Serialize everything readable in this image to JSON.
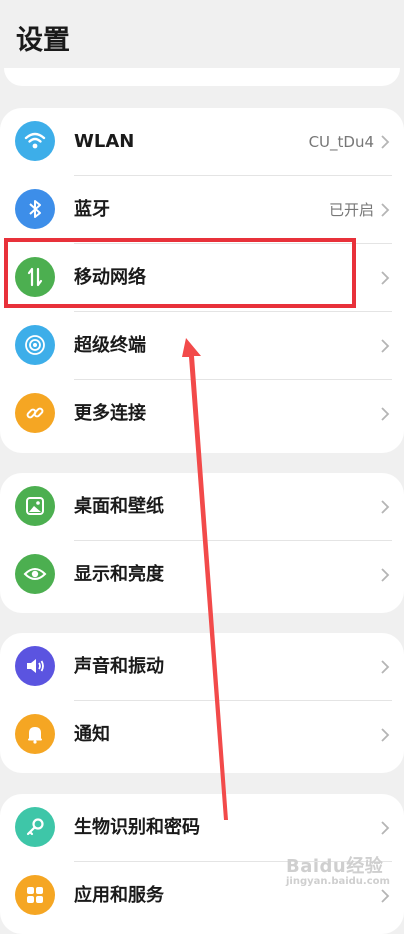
{
  "header": {
    "title": "设置"
  },
  "groups": [
    {
      "items": [
        {
          "label": "WLAN",
          "value": "CU_tDu4",
          "icon": "wifi-icon",
          "color": "#3daee9"
        },
        {
          "label": "蓝牙",
          "value": "已开启",
          "icon": "bluetooth-icon",
          "color": "#3d8ee9"
        },
        {
          "label": "移动网络",
          "value": "",
          "icon": "mobile-data-icon",
          "color": "#4caf50"
        },
        {
          "label": "超级终端",
          "value": "",
          "icon": "super-device-icon",
          "color": "#3daee9"
        },
        {
          "label": "更多连接",
          "value": "",
          "icon": "link-icon",
          "color": "#f5a623"
        }
      ]
    },
    {
      "items": [
        {
          "label": "桌面和壁纸",
          "value": "",
          "icon": "wallpaper-icon",
          "color": "#4caf50"
        },
        {
          "label": "显示和亮度",
          "value": "",
          "icon": "eye-icon",
          "color": "#4caf50"
        }
      ]
    },
    {
      "items": [
        {
          "label": "声音和振动",
          "value": "",
          "icon": "speaker-icon",
          "color": "#5b54e0"
        },
        {
          "label": "通知",
          "value": "",
          "icon": "bell-icon",
          "color": "#f5a623"
        }
      ]
    },
    {
      "items": [
        {
          "label": "生物识别和密码",
          "value": "",
          "icon": "key-icon",
          "color": "#3ec6a8"
        },
        {
          "label": "应用和服务",
          "value": "",
          "icon": "apps-icon",
          "color": "#f5a623"
        }
      ]
    }
  ],
  "annotation": {
    "highlight_color": "#e8313a",
    "arrow_color": "#f24a4a"
  },
  "watermark": {
    "text": "Baidu经验",
    "sub": "jingyan.baidu.com"
  }
}
